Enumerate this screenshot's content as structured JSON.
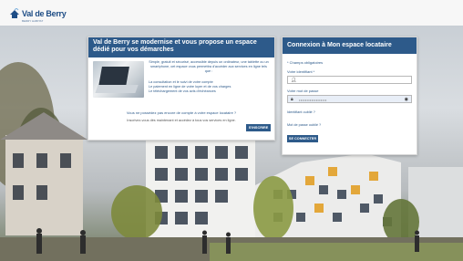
{
  "header": {
    "logo_text": "Val de Berry",
    "logo_subtitle": "BERRY HABITAT"
  },
  "left_card": {
    "title": "Val de Berry se modernise et vous propose un espace dédié pour vos démarches",
    "intro": "Simple, gratuit et sécurisé, accessible depuis un ordinateur, une tablette ou un smartphone, cet espace vous permettra d'accéder aux services en ligne tels que :",
    "services": "La consultation et le suivi de votre compte\nLe paiement en ligne de votre loyer et de vos charges\nLe téléchargement de vos avis d'échéances",
    "question": "Vous ne possédez pas encore de compte à votre espace locataire ?",
    "invite": "Inscrivez-vous dès maintenant et accédez à tous vos services en ligne.",
    "subscribe_label": "S'INSCRIRE"
  },
  "right_card": {
    "title": "Connexion à Mon espace locataire",
    "required_note": "* Champs obligatoires",
    "identifier_label": "Votre identifiant *",
    "password_label": "Votre mot de passe",
    "password_value": "••••••••••••••••••",
    "forgot_identifier": "Identifiant oublié ?",
    "forgot_password": "Mot de passe oublié ?",
    "login_label": "SE CONNECTER"
  }
}
